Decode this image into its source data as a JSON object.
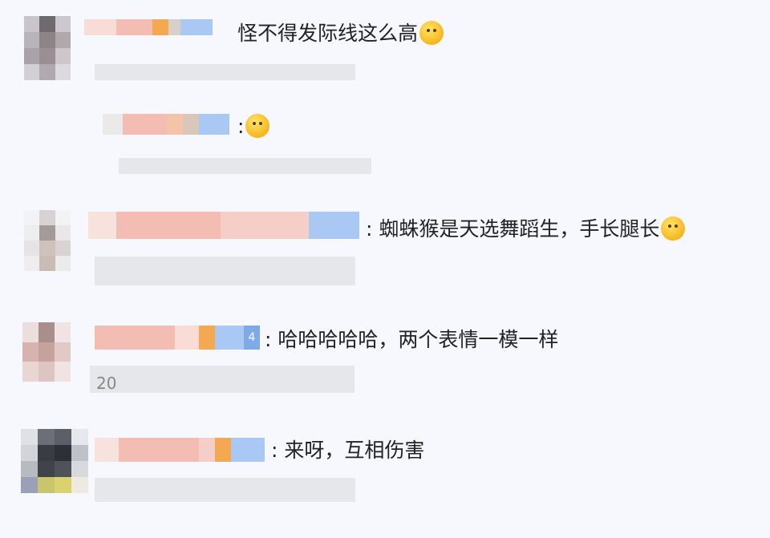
{
  "comments": [
    {
      "id": "c1",
      "text": "怪不得发际线这么高",
      "emoji_icon": "thinking-face-icon",
      "prefix": ""
    },
    {
      "id": "c1r",
      "text": "",
      "emoji_icon": "thinking-face-icon",
      "prefix": ":"
    },
    {
      "id": "c2",
      "text": "蜘蛛猴是天选舞蹈生，手长腿长",
      "emoji_icon": "scream-face-icon",
      "prefix": ":"
    },
    {
      "id": "c3",
      "text": "哈哈哈哈哈，两个表情一模一样",
      "emoji_icon": "",
      "prefix": ":",
      "badge": "4"
    },
    {
      "id": "c4",
      "text": "来呀，互相伤害",
      "emoji_icon": "",
      "prefix": ":"
    }
  ],
  "stray_marks": "20",
  "colors": {
    "background": "#f6f8fd",
    "text": "#222222",
    "blur_pink": "#f3b9b3",
    "blur_blue": "#a9c8f3",
    "blur_orange": "#f5a852"
  }
}
